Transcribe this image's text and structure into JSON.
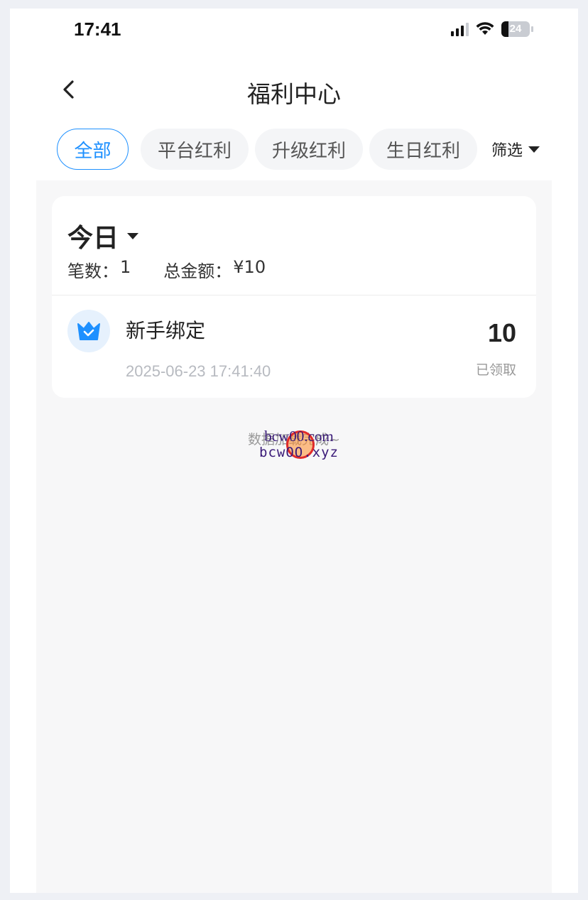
{
  "status_bar": {
    "time": "17:41",
    "battery": "24"
  },
  "header": {
    "title": "福利中心"
  },
  "tabs": [
    {
      "label": "全部",
      "active": true
    },
    {
      "label": "平台红利",
      "active": false
    },
    {
      "label": "升级红利",
      "active": false
    },
    {
      "label": "生日红利",
      "active": false
    }
  ],
  "filter": {
    "label": "筛选"
  },
  "summary": {
    "period": "今日",
    "count_label": "笔数：",
    "count": "1",
    "total_label": "总金额：",
    "total": "¥10"
  },
  "records": [
    {
      "title": "新手绑定",
      "time": "2025-06-23 17:41:40",
      "amount": "10",
      "status": "已领取",
      "icon": "crown-icon"
    }
  ],
  "footer": {
    "load_status": "数据加载完成~"
  },
  "watermark": {
    "line1": "bcw00.com",
    "line2": "bcwOO.xyz"
  },
  "colors": {
    "accent": "#1e90ff",
    "icon_bg": "#e6f1fd",
    "page_bg": "#f7f7f8"
  }
}
